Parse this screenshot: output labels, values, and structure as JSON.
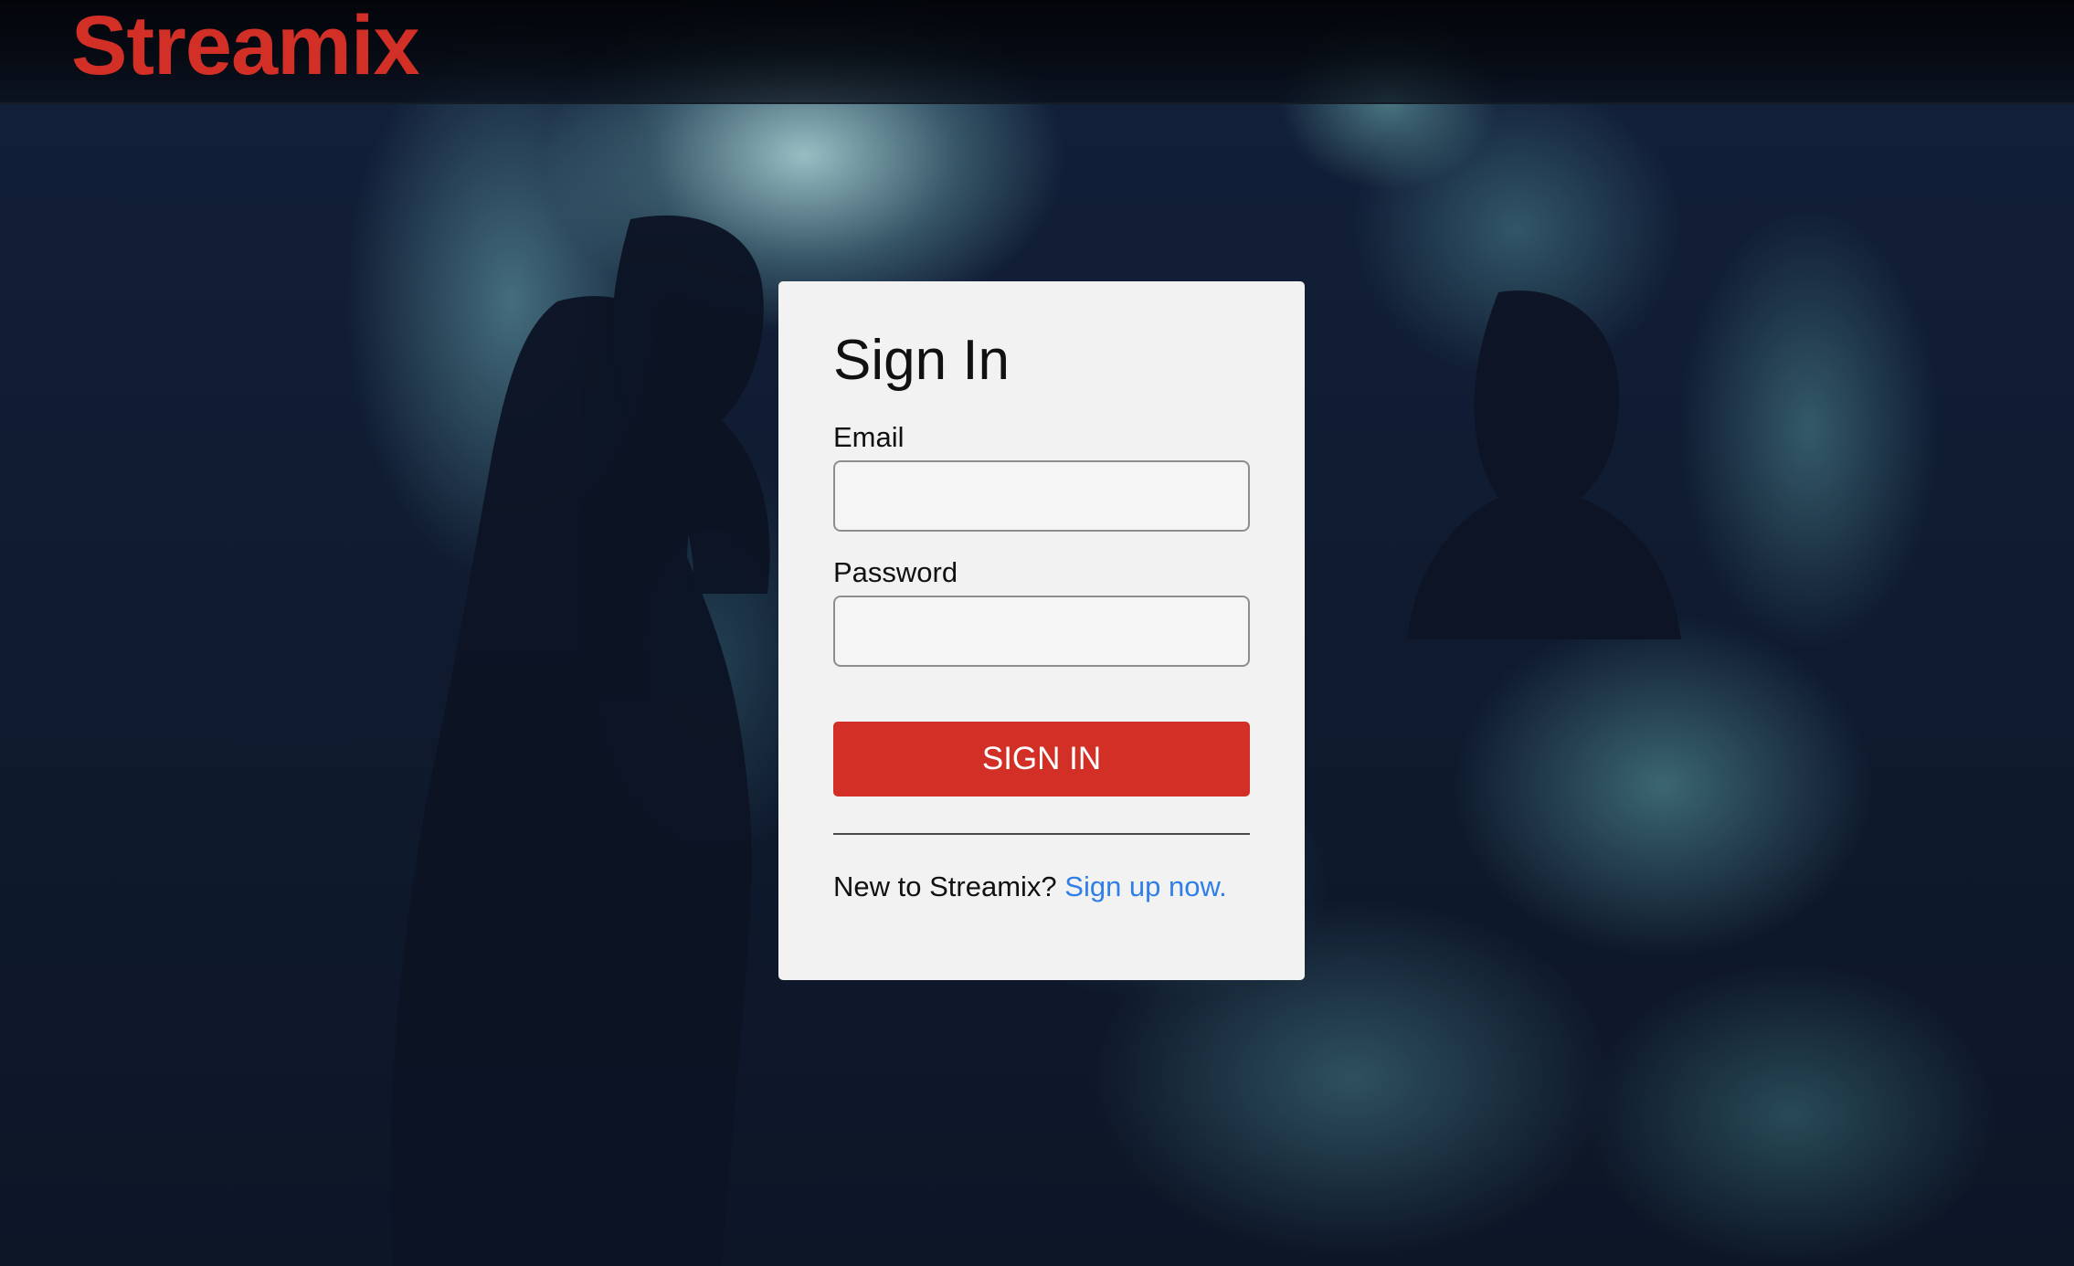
{
  "brand": {
    "name": "Streamix",
    "color": "#d22f27"
  },
  "signin": {
    "title": "Sign In",
    "email": {
      "label": "Email",
      "value": "",
      "placeholder": ""
    },
    "password": {
      "label": "Password",
      "value": "",
      "placeholder": ""
    },
    "button_label": "SIGN IN",
    "footer_prompt": "New to Streamix?",
    "signup_link": "Sign up now."
  },
  "colors": {
    "accent": "#d22f27",
    "link": "#2f7fe6",
    "card": "#f2f2f2"
  }
}
